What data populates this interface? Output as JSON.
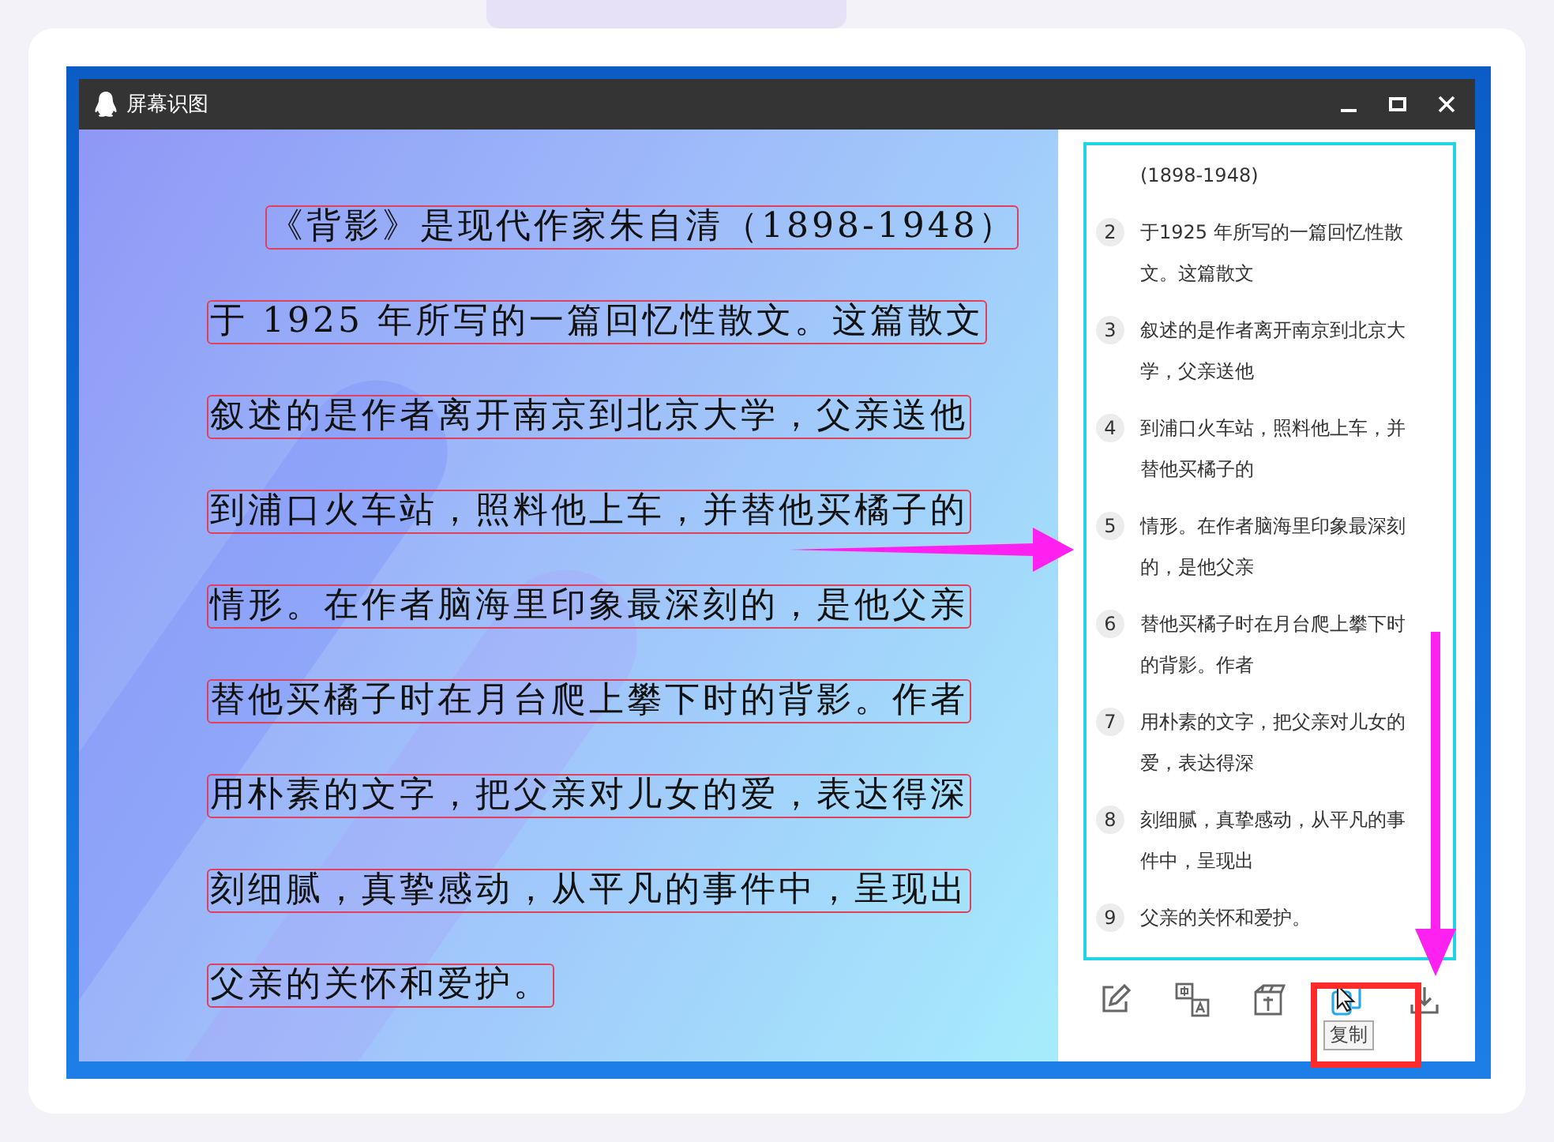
{
  "window": {
    "title": "屏幕识图"
  },
  "image_lines": [
    {
      "text": "《背影》是现代作家朱自清（1898-1948）"
    },
    {
      "text": "于 1925 年所写的一篇回忆性散文。这篇散文"
    },
    {
      "text": "叙述的是作者离开南京到北京大学，父亲送他"
    },
    {
      "text": "到浦口火车站，照料他上车，并替他买橘子的"
    },
    {
      "text": "情形。在作者脑海里印象最深刻的，是他父亲"
    },
    {
      "text": "替他买橘子时在月台爬上攀下时的背影。作者"
    },
    {
      "text": "用朴素的文字，把父亲对儿女的爱，表达得深"
    },
    {
      "text": "刻细腻，真挚感动，从平凡的事件中，呈现出"
    },
    {
      "text": "父亲的关怀和爱护。"
    }
  ],
  "results": [
    {
      "lines": [
        "(1898-1948)"
      ]
    },
    {
      "number": "2",
      "lines": [
        "于1925 年所写的一篇回忆性散",
        "文。这篇散文"
      ]
    },
    {
      "number": "3",
      "lines": [
        "叙述的是作者离开南京到北京大",
        "学，父亲送他"
      ]
    },
    {
      "number": "4",
      "lines": [
        "到浦口火车站，照料他上车，并",
        "替他买橘子的"
      ]
    },
    {
      "number": "5",
      "lines": [
        "情形。在作者脑海里印象最深刻",
        "的，是他父亲"
      ]
    },
    {
      "number": "6",
      "lines": [
        "替他买橘子时在月台爬上攀下时",
        "的背影。作者"
      ]
    },
    {
      "number": "7",
      "lines": [
        "用朴素的文字，把父亲对儿女的",
        "爱，表达得深"
      ]
    },
    {
      "number": "8",
      "lines": [
        "刻细腻，真挚感动，从平凡的事",
        "件中，呈现出"
      ]
    },
    {
      "number": "9",
      "lines": [
        "父亲的关怀和爱护。"
      ]
    }
  ],
  "toolbar": [
    {
      "kind": "edit",
      "hovered": false
    },
    {
      "kind": "translate",
      "hovered": false
    },
    {
      "kind": "box",
      "hovered": false
    },
    {
      "kind": "copy",
      "hovered": true,
      "tooltip": "复制"
    },
    {
      "kind": "download",
      "hovered": false
    }
  ]
}
